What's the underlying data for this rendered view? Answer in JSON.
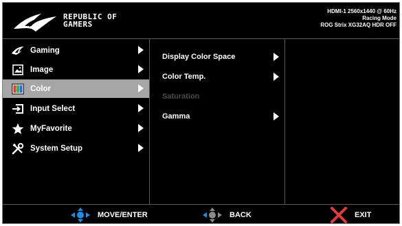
{
  "header": {
    "brand_line1": "REPUBLIC OF",
    "brand_line2": "GAMERS",
    "info_line1": "HDMI-1 2560x1440 @ 60Hz",
    "info_line2": "Racing Mode",
    "info_line3": "ROG Strix XG32AQ HDR OFF"
  },
  "main_menu": [
    {
      "label": "Gaming",
      "icon": "rog-eye-icon"
    },
    {
      "label": "Image",
      "icon": "image-icon"
    },
    {
      "label": "Color",
      "icon": "color-icon",
      "selected": true
    },
    {
      "label": "Input Select",
      "icon": "input-select-icon"
    },
    {
      "label": "MyFavorite",
      "icon": "star-icon"
    },
    {
      "label": "System Setup",
      "icon": "tools-icon"
    }
  ],
  "sub_menu": [
    {
      "label": "Display Color Space",
      "enabled": true,
      "has_arrow": true
    },
    {
      "label": "Color Temp.",
      "enabled": true,
      "has_arrow": true
    },
    {
      "label": "Saturation",
      "enabled": false,
      "has_arrow": false
    },
    {
      "label": "Gamma",
      "enabled": true,
      "has_arrow": true
    }
  ],
  "footer": {
    "move_enter": "MOVE/ENTER",
    "back": "BACK",
    "exit": "EXIT"
  },
  "colors": {
    "background": "#000000",
    "selected": "#a6a6a6",
    "nav_blue": "#1a8fe6",
    "exit_red": "#e23b3b",
    "disabled_text": "#4a4a4a"
  }
}
